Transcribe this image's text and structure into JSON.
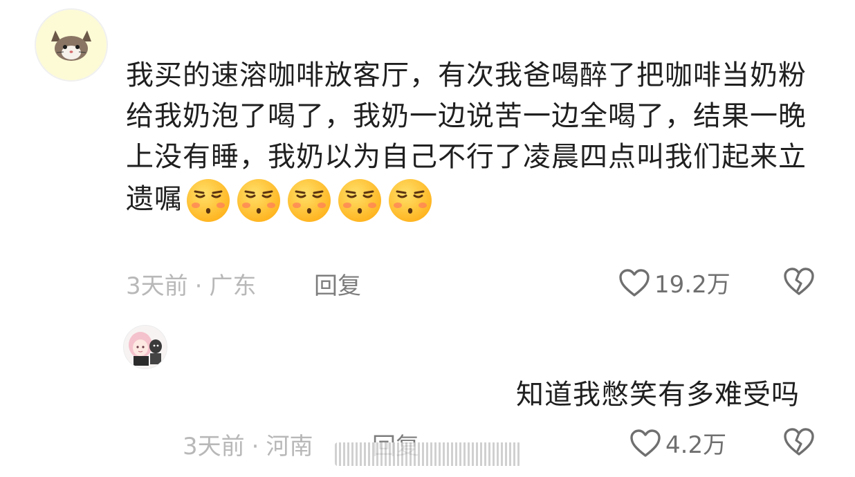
{
  "comment": {
    "text": "我买的速溶咖啡放客厅，有次我爸喝醉了把咖啡当奶粉给我奶泡了喝了，我奶一边说苦一边全喝了，结果一晚上没有睡，我奶以为自己不行了凌晨四点叫我们起来立遗嘱",
    "emoji_name": "unamused-face-emoji",
    "emoji_count": 5,
    "time": "3天前",
    "separator": "·",
    "location": "广东",
    "reply_label": "回复",
    "likes": "19.2万",
    "like_icon": "heart-outline-icon",
    "dislike_icon": "broken-heart-icon"
  },
  "reply": {
    "text": "知道我憋笑有多难受吗",
    "time": "3天前",
    "separator": "·",
    "location": "河南",
    "reply_label": "回复",
    "likes": "4.2万",
    "like_icon": "heart-outline-icon",
    "dislike_icon": "broken-heart-icon"
  },
  "colors": {
    "text_primary": "#1f1f1f",
    "text_meta": "#b8b8b8",
    "text_secondary": "#6f6f6f",
    "emoji_face": "#ffb21c"
  }
}
